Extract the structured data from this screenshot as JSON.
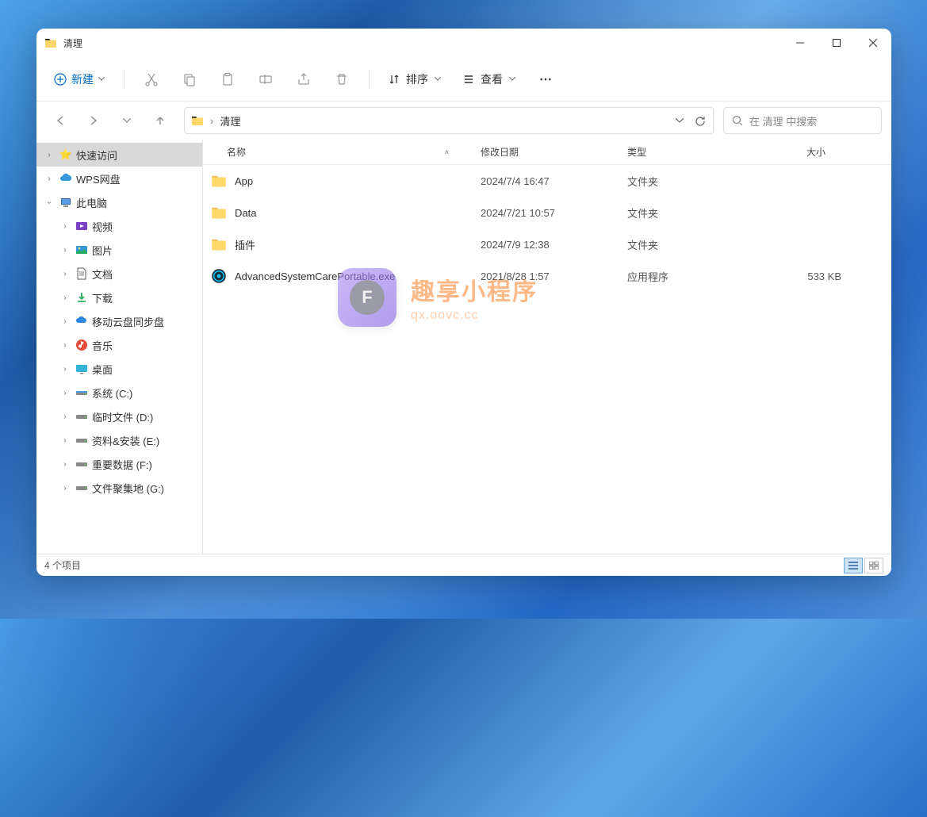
{
  "window": {
    "title": "清理"
  },
  "toolbar": {
    "new_label": "新建",
    "sort_label": "排序",
    "view_label": "查看"
  },
  "address": {
    "path": "清理"
  },
  "search": {
    "placeholder": "在 清理 中搜索"
  },
  "sidebar": {
    "quick_access": "快速访问",
    "wps": "WPS网盘",
    "this_pc": "此电脑",
    "videos": "视频",
    "pictures": "图片",
    "documents": "文档",
    "downloads": "下载",
    "cloud_sync": "移动云盘同步盘",
    "music": "音乐",
    "desktop": "桌面",
    "drive_c": "系统 (C:)",
    "drive_d": "临时文件 (D:)",
    "drive_e": "资料&安装 (E:)",
    "drive_f": "重要数据 (F:)",
    "drive_g": "文件聚集地 (G:)"
  },
  "columns": {
    "name": "名称",
    "date": "修改日期",
    "type": "类型",
    "size": "大小"
  },
  "files": [
    {
      "name": "App",
      "date": "2024/7/4 16:47",
      "type": "文件夹",
      "size": "",
      "icon": "folder"
    },
    {
      "name": "Data",
      "date": "2024/7/21 10:57",
      "type": "文件夹",
      "size": "",
      "icon": "folder"
    },
    {
      "name": "插件",
      "date": "2024/7/9 12:38",
      "type": "文件夹",
      "size": "",
      "icon": "folder"
    },
    {
      "name": "AdvancedSystemCarePortable.exe",
      "date": "2021/8/28 1:57",
      "type": "应用程序",
      "size": "533 KB",
      "icon": "exe"
    }
  ],
  "status": {
    "text": "4 个项目"
  },
  "watermark": {
    "title": "趣享小程序",
    "sub": "qx.oovc.cc",
    "badge": "F"
  }
}
